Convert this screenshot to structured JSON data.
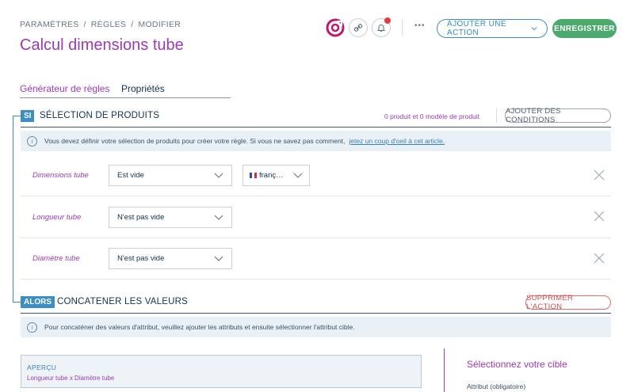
{
  "breadcrumb": [
    "PARAMÈTRES",
    "RÈGLES",
    "MODIFIER"
  ],
  "page_title": "Calcul dimensions tube",
  "header": {
    "add_action_label": "AJOUTER UNE ACTION",
    "save_label": "ENREGISTRER",
    "more_label": "•••"
  },
  "tabs": [
    "Générateur de règles",
    "Propriétés"
  ],
  "si_section": {
    "badge": "SI",
    "title": "SÉLECTION DE PRODUITS",
    "count_text": "0 produit et 0 modèle de produit",
    "add_conditions_label": "AJOUTER DES CONDITIONS",
    "info_text": "Vous devez définir votre sélection de produits pour créer votre règle. Si vous ne savez pas comment,",
    "info_link": "jetez un coup d'oeil à cet article."
  },
  "conditions": [
    {
      "label": "Dimensions tube",
      "operator": "Est vide",
      "locale": "franç…",
      "has_locale": true
    },
    {
      "label": "Longueur tube",
      "operator": "N'est pas vide",
      "has_locale": false
    },
    {
      "label": "Diamètre tube",
      "operator": "N'est pas vide",
      "has_locale": false
    }
  ],
  "alors_section": {
    "badge": "ALORS",
    "title": "CONCATENER LES VALEURS",
    "delete_label": "SUPPRIMER L'ACTION",
    "info_text": "Pour concaténer des valeurs d'attribut, veuillez ajouter les attributs et ensuite sélectionner l'attribut cible."
  },
  "preview": {
    "title": "APERÇU",
    "value": "Longueur tube x Diamètre tube"
  },
  "target": {
    "title": "Sélectionnez votre cible",
    "attribute_label": "Attribut (obligatoire)"
  },
  "colors": {
    "accent_purple": "#9a3bb3",
    "primary_blue": "#3a8ec4",
    "save_green": "#4caa6e",
    "notification_red": "#e23d3d"
  }
}
